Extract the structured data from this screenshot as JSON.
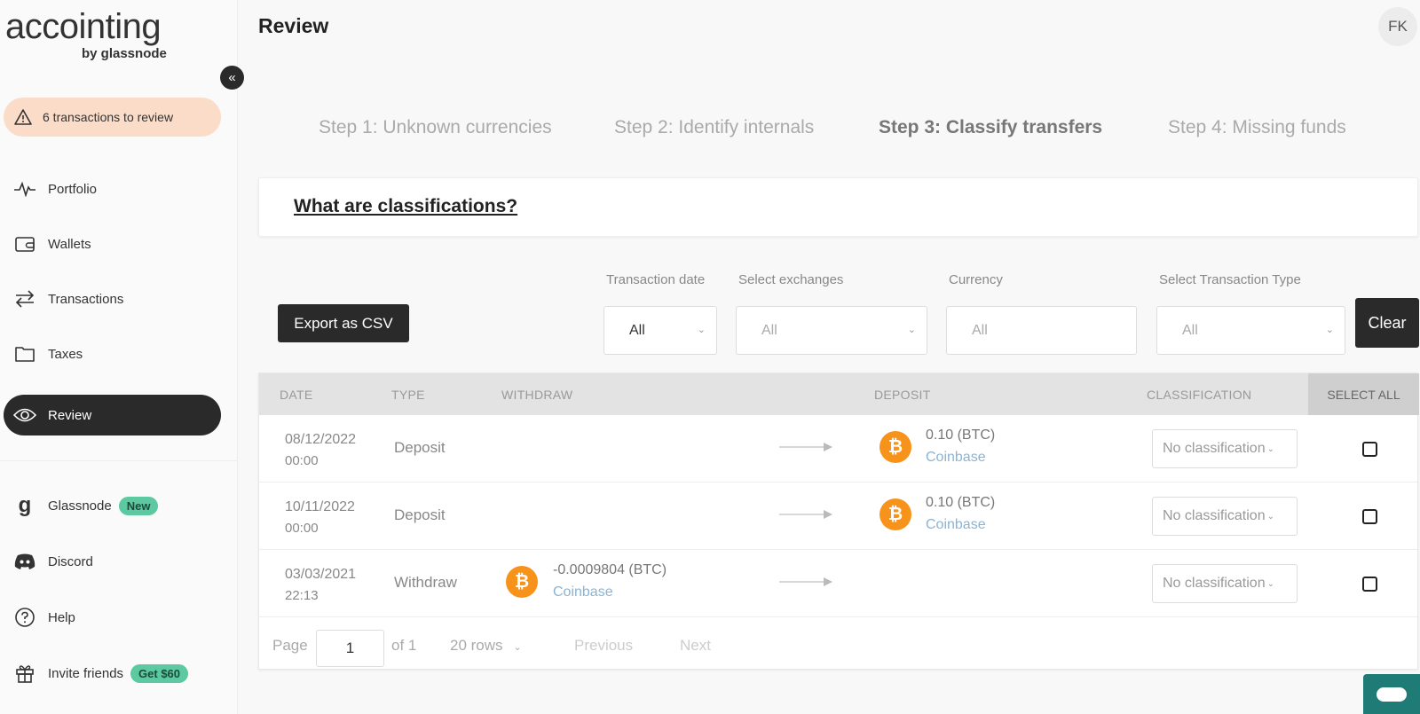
{
  "brand": {
    "name": "accointing",
    "sub": "by glassnode"
  },
  "sidebar": {
    "alert": "6 transactions to review",
    "items": [
      {
        "label": "Portfolio",
        "icon": "pulse-icon"
      },
      {
        "label": "Wallets",
        "icon": "wallet-icon"
      },
      {
        "label": "Transactions",
        "icon": "transfer-icon"
      },
      {
        "label": "Taxes",
        "icon": "folder-icon"
      },
      {
        "label": "Review",
        "icon": "eye-icon",
        "active": true
      },
      {
        "label": "Glassnode",
        "icon": "glassnode-icon",
        "badge": "New"
      },
      {
        "label": "Discord",
        "icon": "discord-icon"
      },
      {
        "label": "Help",
        "icon": "help-icon"
      },
      {
        "label": "Invite friends",
        "icon": "gift-icon",
        "badge": "Get $60"
      }
    ]
  },
  "header": {
    "title": "Review",
    "avatar": "FK"
  },
  "steps": [
    {
      "label": "Step 1: Unknown currencies"
    },
    {
      "label": "Step 2: Identify internals"
    },
    {
      "label": "Step 3: Classify transfers",
      "active": true
    },
    {
      "label": "Step 4: Missing funds"
    }
  ],
  "info": {
    "link": "What are classifications?"
  },
  "filters": {
    "export_label": "Export as CSV",
    "date": {
      "label": "Transaction date",
      "value": "All"
    },
    "exchanges": {
      "label": "Select exchanges",
      "value": "All"
    },
    "currency": {
      "label": "Currency",
      "value": "All"
    },
    "type": {
      "label": "Select Transaction Type",
      "value": "All"
    },
    "clear_label": "Clear"
  },
  "table": {
    "headers": {
      "date": "DATE",
      "type": "TYPE",
      "withdraw": "WITHDRAW",
      "deposit": "DEPOSIT",
      "classification": "CLASSIFICATION",
      "select_all": "SELECT ALL"
    },
    "rows": [
      {
        "date": "08/12/2022",
        "time": "00:00",
        "type": "Deposit",
        "withdraw_amount": "",
        "withdraw_source": "",
        "deposit_amount": "0.10 (BTC)",
        "deposit_source": "Coinbase",
        "classification": "No classification"
      },
      {
        "date": "10/11/2022",
        "time": "00:00",
        "type": "Deposit",
        "withdraw_amount": "",
        "withdraw_source": "",
        "deposit_amount": "0.10 (BTC)",
        "deposit_source": "Coinbase",
        "classification": "No classification"
      },
      {
        "date": "03/03/2021",
        "time": "22:13",
        "type": "Withdraw",
        "withdraw_amount": "-0.0009804 (BTC)",
        "withdraw_source": "Coinbase",
        "deposit_amount": "",
        "deposit_source": "",
        "classification": "No classification"
      }
    ],
    "coin_symbol": "₿"
  },
  "pagination": {
    "page_label": "Page",
    "page": "1",
    "of_label": "of 1",
    "rows_label": "20 rows",
    "previous": "Previous",
    "next": "Next"
  },
  "colors": {
    "accent_dark": "#2a2a2a",
    "btc": "#f7931a",
    "badge_green": "#5cc9a0",
    "alert_bg": "#fbdcc8",
    "chat": "#1f7b75"
  }
}
